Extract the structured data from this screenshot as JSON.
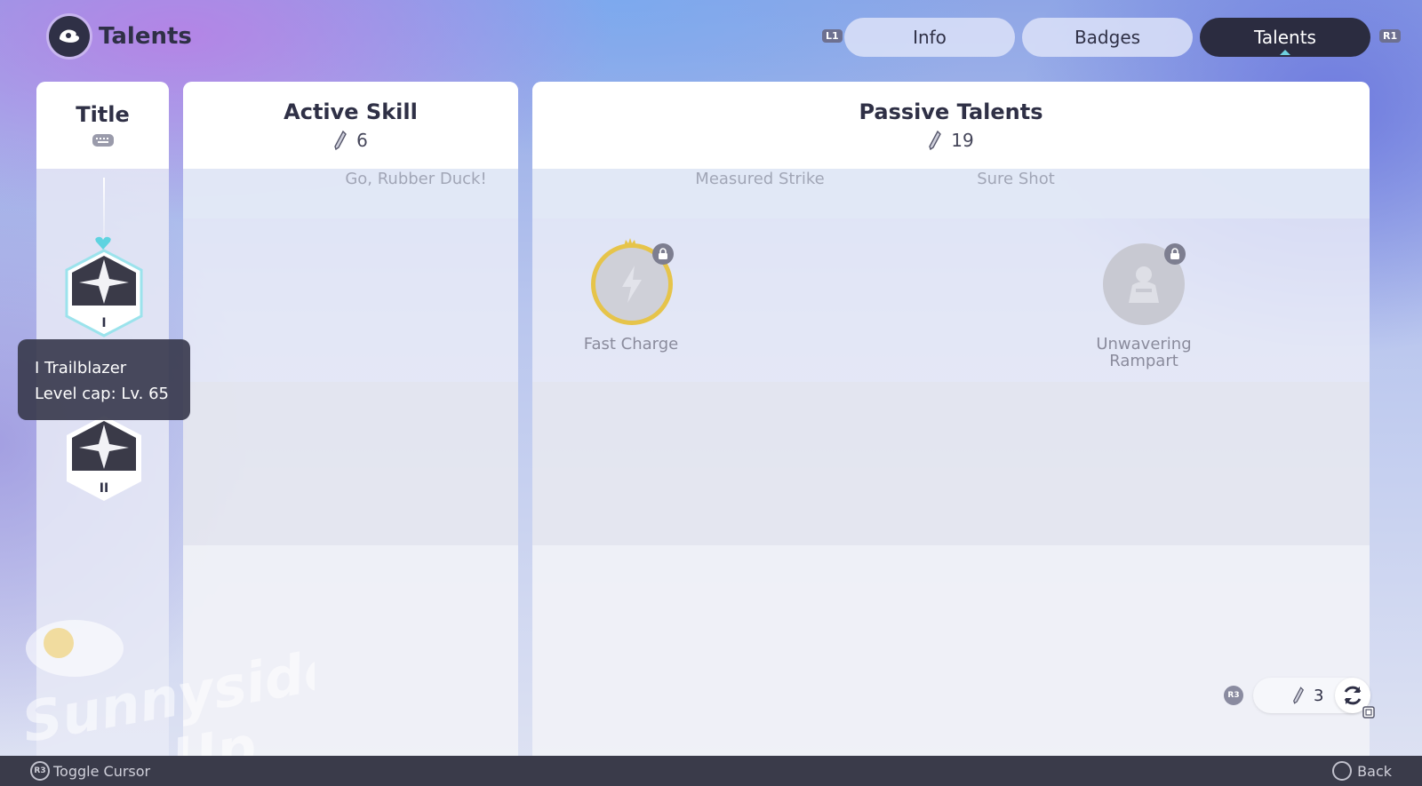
{
  "header": {
    "title": "Talents",
    "hint_left": "L1",
    "hint_right": "R1",
    "tabs": [
      {
        "label": "Info",
        "active": false
      },
      {
        "label": "Badges",
        "active": false
      },
      {
        "label": "Talents",
        "active": true
      }
    ]
  },
  "columns": {
    "title": {
      "heading": "Title"
    },
    "active": {
      "heading": "Active Skill",
      "count": "6",
      "faded_label": "Go, Rubber Duck!"
    },
    "passive": {
      "heading": "Passive Talents",
      "count": "19",
      "faded_labels": [
        "Measured Strike",
        "Sure Shot"
      ],
      "talents": [
        {
          "name": "Fast Charge",
          "locked": true,
          "icon": "lightning-icon"
        },
        {
          "name": "Unwavering Rampart",
          "locked": true,
          "icon": "shield-figure-icon"
        }
      ]
    }
  },
  "title_badges": [
    {
      "numeral": "I",
      "icon": "sparkle-badge-icon"
    },
    {
      "numeral": "II",
      "icon": "sparkle-badge-icon"
    }
  ],
  "tooltip": {
    "line1": "I Trailblazer",
    "line2": "Level cap: Lv. 65"
  },
  "refresh": {
    "hint": "R3",
    "count": "3"
  },
  "footer": {
    "left_hint": "R3",
    "left_label": "Toggle Cursor",
    "right_label": "Back"
  },
  "watermark": "Sunnyside Up",
  "colors": {
    "dark": "#2b2c40",
    "gold": "#e6c44a",
    "accent": "#6fd0e0"
  }
}
